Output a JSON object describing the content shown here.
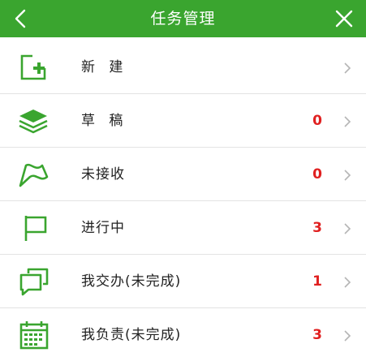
{
  "header": {
    "title": "任务管理",
    "back_icon": "chevron-left-icon",
    "close_icon": "close-icon",
    "background": "#3aa52f"
  },
  "items": [
    {
      "label": "新 建",
      "count": "",
      "icon": "add-task-icon"
    },
    {
      "label": "草 稿",
      "count": "0",
      "icon": "layers-icon"
    },
    {
      "label": "未接收",
      "count": "0",
      "icon": "flag-outline-icon"
    },
    {
      "label": "进行中",
      "count": "3",
      "icon": "flag-icon"
    },
    {
      "label": "我交办(未完成)",
      "count": "1",
      "icon": "chat-bubbles-icon"
    },
    {
      "label": "我负责(未完成)",
      "count": "3",
      "icon": "calendar-icon"
    }
  ],
  "colors": {
    "accent": "#3aa52f",
    "count": "#e02020"
  }
}
